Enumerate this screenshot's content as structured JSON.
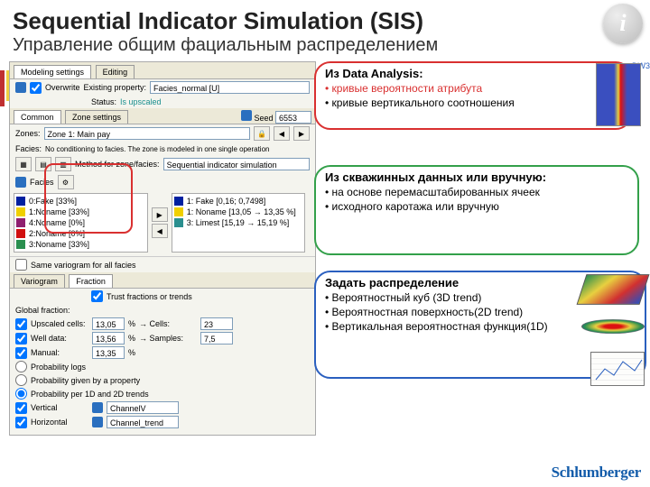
{
  "header": {
    "title": "Sequential Indicator Simulation (SIS)",
    "subtitle": "Управление общим фациальным распределением",
    "info_icon": "i"
  },
  "panel": {
    "tab1": "Modeling settings",
    "tab2": "Editing",
    "overwrite_icon": "arrow-icon",
    "existing_label": "Existing property:",
    "existing_value": "Facies_normal [U]",
    "status_label": "Status:",
    "status_value": "Is upscaled",
    "common_tab": "Common",
    "zone_tab": "Zone settings",
    "seed_label": "Seed",
    "seed_value": "6553",
    "zones_label": "Zones:",
    "zones_value": "Zone 1: Main pay",
    "facies_tab": "Facies:",
    "facies_msg": "No conditioning to facies. The zone is modeled in one single operation",
    "section_label": "Facies",
    "method_label": "Method for zone/facies:",
    "method_value": "Sequential indicator simulation",
    "facies_items": [
      {
        "color": "#0020a0",
        "label": "0:Fake [33%]"
      },
      {
        "color": "#f0d000",
        "label": "1:Noname [33%]"
      },
      {
        "color": "#8f1f6f",
        "label": "4:Noname [0%]"
      },
      {
        "color": "#d11010",
        "label": "2:Noname [0%]"
      },
      {
        "color": "#2a8f4f",
        "label": "3:Noname [33%]"
      }
    ],
    "class_items": [
      "1: Fake [0,16; 0,7498]",
      "1: Noname [13,05 → 13,35 %]",
      "3: Limest [15,19 → 15,19 %]"
    ],
    "same_var_label": "Same variogram for all facies",
    "var_tab": "Variogram",
    "frac_tab": "Fraction",
    "trust_label": "Trust fractions or trends",
    "global_label": "Global fraction:",
    "upscaled_label": "Upscaled cells:",
    "upscaled_val": "13,05",
    "cells_label": "→ Cells:",
    "cells_val": "23",
    "welldata_label": "Well data:",
    "welldata_val": "13,56",
    "samples_label": "→ Samples:",
    "samples_val": "7,5",
    "manual_label": "Manual:",
    "manual_val": "13,35",
    "r_prob_log": "Probability logs",
    "r_prob_prop": "Probability given by a property",
    "r_prob_1d2d": "Probability per 1D and 2D trends",
    "vert_label": "Vertical",
    "channelv": "ChannelV",
    "horz_label": "Horizontal",
    "channel_tr": "Channel_trend"
  },
  "annot_red": {
    "head": "Из Data Analysis:",
    "b1": "• кривые вероятности атрибута",
    "b2": "• кривые вертикального соотношения"
  },
  "annot_green": {
    "head": "Из скважинных данных или вручную:",
    "b1": "• на основе перемасштабированных ячеек",
    "b2": "• исходного каротажа или вручную"
  },
  "annot_blue": {
    "head": "Задать распределение",
    "b1": "• Вероятностный куб (3D trend)",
    "b2": "• Вероятностная поверхность(2D trend)",
    "b3": "• Вертикальная вероятностная функция(1D)"
  },
  "well_label": "DW3",
  "footer": {
    "logo": "Schlumberger"
  }
}
